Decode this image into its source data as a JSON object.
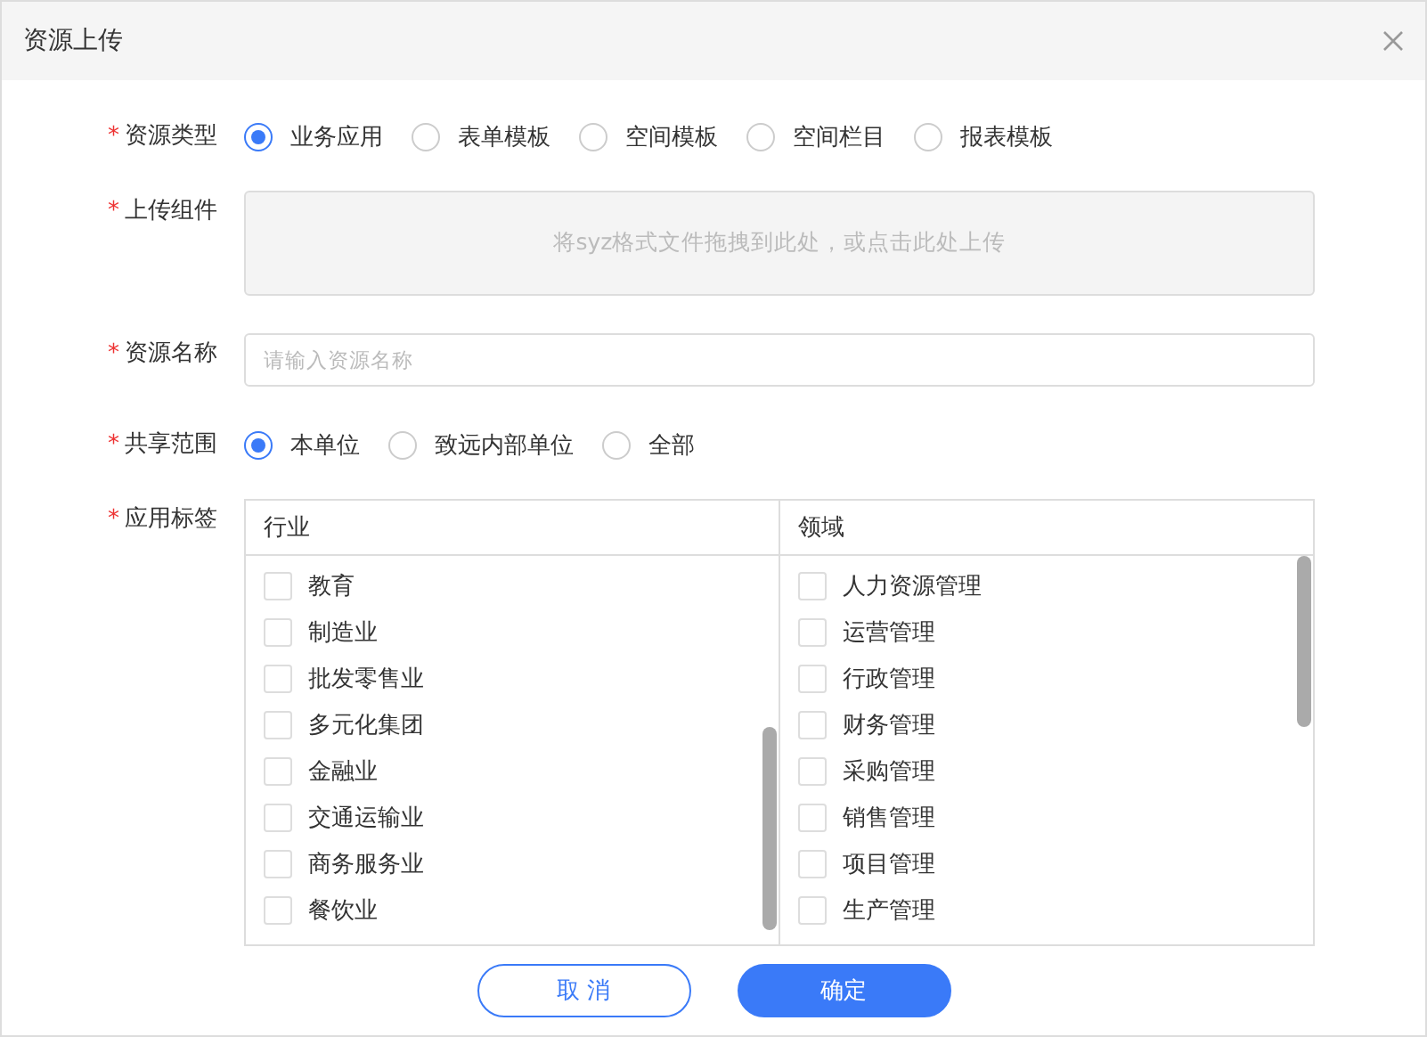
{
  "window": {
    "title": "资源上传"
  },
  "fields": [
    {
      "kind": "radio",
      "label": "资源类型",
      "required_mark": "*",
      "options": [
        {
          "label": "业务应用",
          "selected": true
        },
        {
          "label": "表单模板",
          "selected": false
        },
        {
          "label": "空间模板",
          "selected": false
        },
        {
          "label": "空间栏目",
          "selected": false
        },
        {
          "label": "报表模板",
          "selected": false
        }
      ]
    },
    {
      "kind": "upload",
      "label": "上传组件",
      "required_mark": "*",
      "hint": "将syz格式文件拖拽到此处，或点击此处上传"
    },
    {
      "kind": "text",
      "label": "资源名称",
      "required_mark": "*",
      "placeholder": "请输入资源名称"
    },
    {
      "kind": "radio",
      "label": "共享范围",
      "required_mark": "*",
      "options": [
        {
          "label": "本单位",
          "selected": true
        },
        {
          "label": "致远内部单位",
          "selected": false
        },
        {
          "label": "全部",
          "selected": false
        }
      ]
    },
    {
      "kind": "tags",
      "label": "应用标签",
      "required_mark": "*",
      "columns": [
        {
          "title": "行业",
          "items": [
            {
              "label": "教育",
              "checked": false
            },
            {
              "label": "制造业",
              "checked": false
            },
            {
              "label": "批发零售业",
              "checked": false
            },
            {
              "label": "多元化集团",
              "checked": false
            },
            {
              "label": "金融业",
              "checked": false
            },
            {
              "label": "交通运输业",
              "checked": false
            },
            {
              "label": "商务服务业",
              "checked": false
            },
            {
              "label": "餐饮业",
              "checked": false
            }
          ]
        },
        {
          "title": "领域",
          "items": [
            {
              "label": "人力资源管理",
              "checked": false
            },
            {
              "label": "运营管理",
              "checked": false
            },
            {
              "label": "行政管理",
              "checked": false
            },
            {
              "label": "财务管理",
              "checked": false
            },
            {
              "label": "采购管理",
              "checked": false
            },
            {
              "label": "销售管理",
              "checked": false
            },
            {
              "label": "项目管理",
              "checked": false
            },
            {
              "label": "生产管理",
              "checked": false
            }
          ]
        }
      ]
    }
  ],
  "buttons": [
    {
      "kind": "secondary",
      "label": "取 消"
    },
    {
      "kind": "primary",
      "label": "确定"
    }
  ]
}
